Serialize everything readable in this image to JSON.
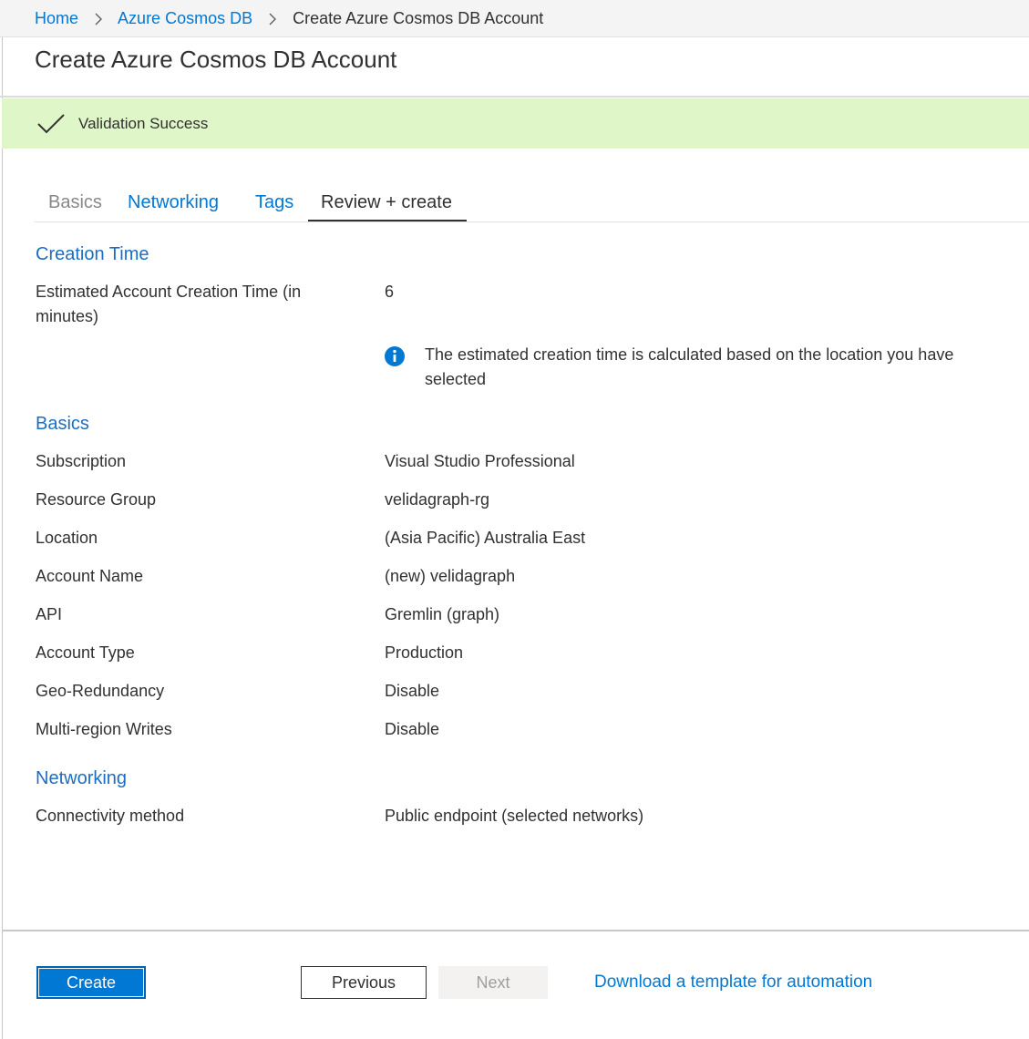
{
  "breadcrumb": {
    "items": [
      "Home",
      "Azure Cosmos DB"
    ],
    "current": "Create Azure Cosmos DB Account"
  },
  "page": {
    "title": "Create Azure Cosmos DB Account"
  },
  "banner": {
    "text": "Validation Success",
    "color": "#dff6c9"
  },
  "tabs": [
    {
      "label": "Basics",
      "state": "disabled"
    },
    {
      "label": "Networking",
      "state": "link"
    },
    {
      "label": "Tags",
      "state": "link"
    },
    {
      "label": "Review + create",
      "state": "active"
    }
  ],
  "sections": {
    "creation_time": {
      "heading": "Creation Time",
      "fields": [
        {
          "label": "Estimated Account Creation Time (in minutes)",
          "value": "6"
        }
      ],
      "info": "The estimated creation time is calculated based on the location you have selected"
    },
    "basics": {
      "heading": "Basics",
      "fields": [
        {
          "label": "Subscription",
          "value": "Visual Studio Professional"
        },
        {
          "label": "Resource Group",
          "value": "velidagraph-rg"
        },
        {
          "label": "Location",
          "value": "(Asia Pacific) Australia East"
        },
        {
          "label": "Account Name",
          "value": "(new) velidagraph"
        },
        {
          "label": "API",
          "value": "Gremlin (graph)"
        },
        {
          "label": "Account Type",
          "value": "Production"
        },
        {
          "label": "Geo-Redundancy",
          "value": "Disable"
        },
        {
          "label": "Multi-region Writes",
          "value": "Disable"
        }
      ]
    },
    "networking": {
      "heading": "Networking",
      "fields": [
        {
          "label": "Connectivity method",
          "value": "Public endpoint (selected networks)"
        }
      ]
    }
  },
  "footer": {
    "create_label": "Create",
    "previous_label": "Previous",
    "next_label": "Next",
    "download_label": "Download a template for automation"
  },
  "colors": {
    "accent": "#0078d4",
    "heading": "#1b6ec2",
    "success_banner": "#dff6c9"
  },
  "icons": {
    "breadcrumb_separator": "chevron-right-icon",
    "banner": "checkmark-icon",
    "info": "info-icon"
  }
}
